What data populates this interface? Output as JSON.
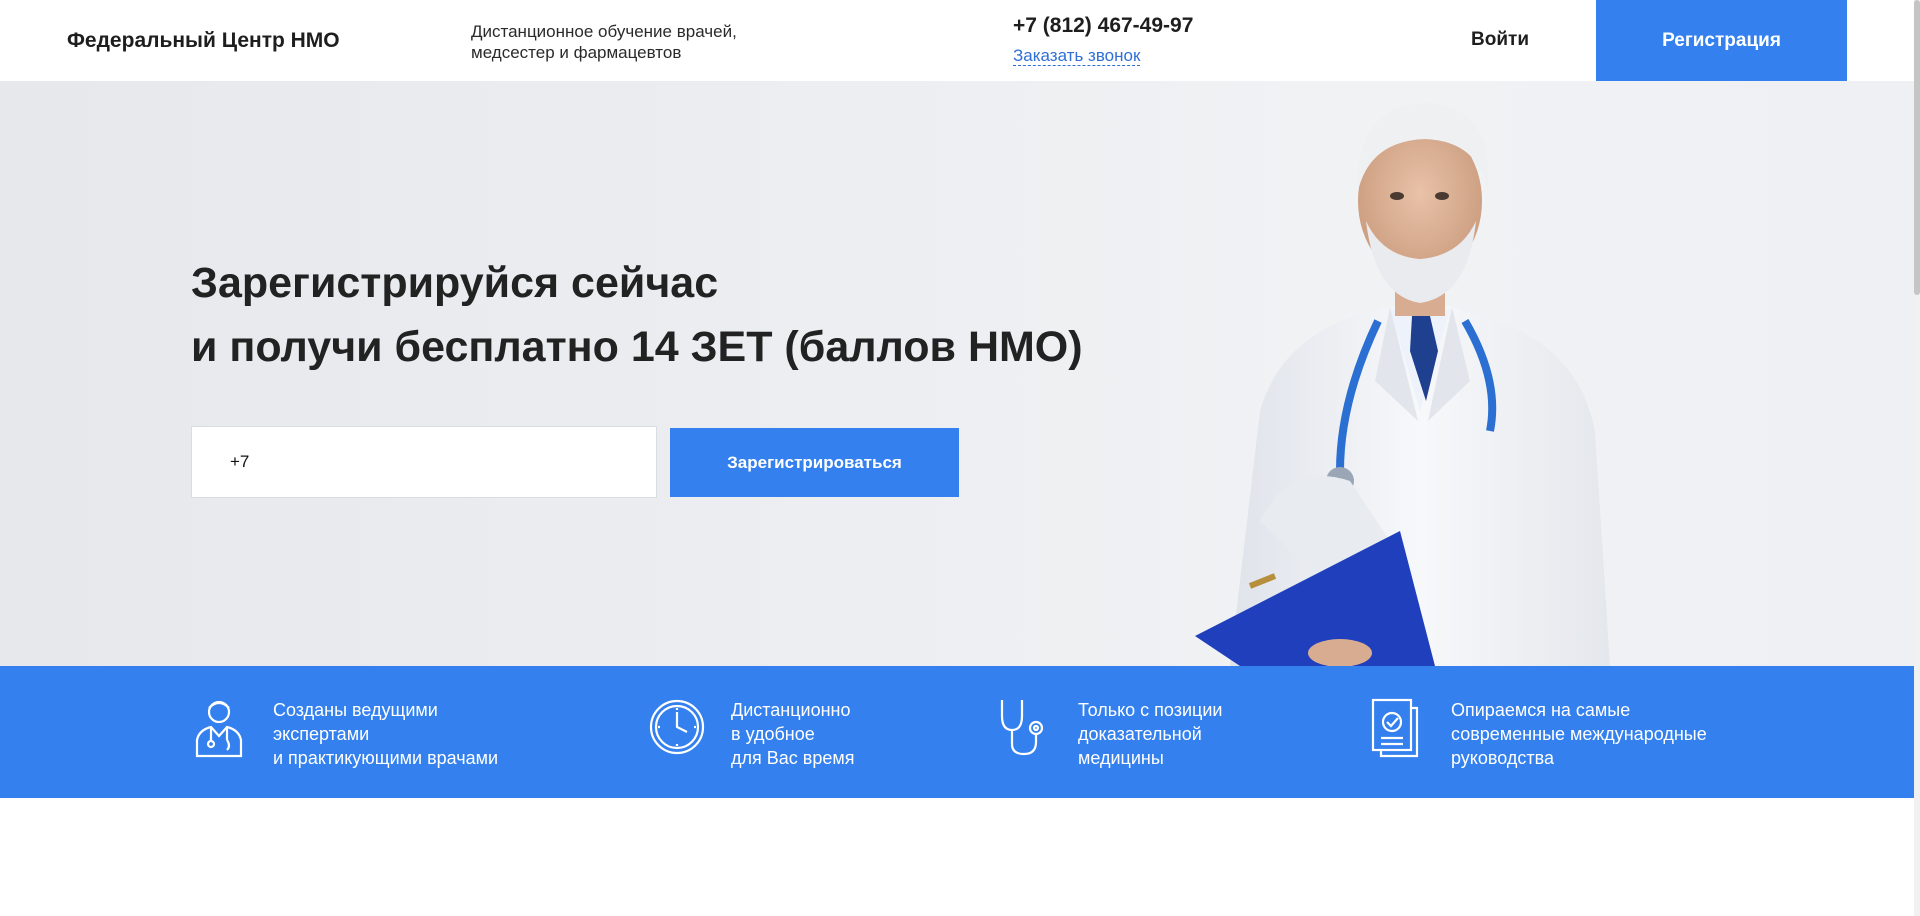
{
  "header": {
    "logo": "Федеральный Центр НМО",
    "tagline_line1": "Дистанционное обучение врачей,",
    "tagline_line2": "медсестер и фармацевтов",
    "phone": "+7 (812) 467-49-97",
    "callback_link": "Заказать звонок",
    "login": "Войти",
    "register": "Регистрация"
  },
  "hero": {
    "title_line1": "Зарегистрируйся сейчас",
    "title_line2": "и получи бесплатно 14 ЗЕТ (баллов НМО)",
    "phone_input_value": "+7",
    "submit_label": "Зарегистрироваться"
  },
  "features": [
    {
      "icon": "doctor-icon",
      "lines": [
        "Созданы ведущими",
        "экспертами",
        "и практикующими врачами"
      ]
    },
    {
      "icon": "clock-icon",
      "lines": [
        "Дистанционно",
        "в удобное",
        "для Вас время"
      ]
    },
    {
      "icon": "stethoscope-icon",
      "lines": [
        "Только с позиции",
        "доказательной",
        "медицины"
      ]
    },
    {
      "icon": "document-check-icon",
      "lines": [
        "Опираемся на самые",
        "современные международные",
        "руководства"
      ]
    }
  ],
  "colors": {
    "accent": "#3380ee",
    "link": "#2f6fd6",
    "hero_bg": "#eceef1"
  }
}
